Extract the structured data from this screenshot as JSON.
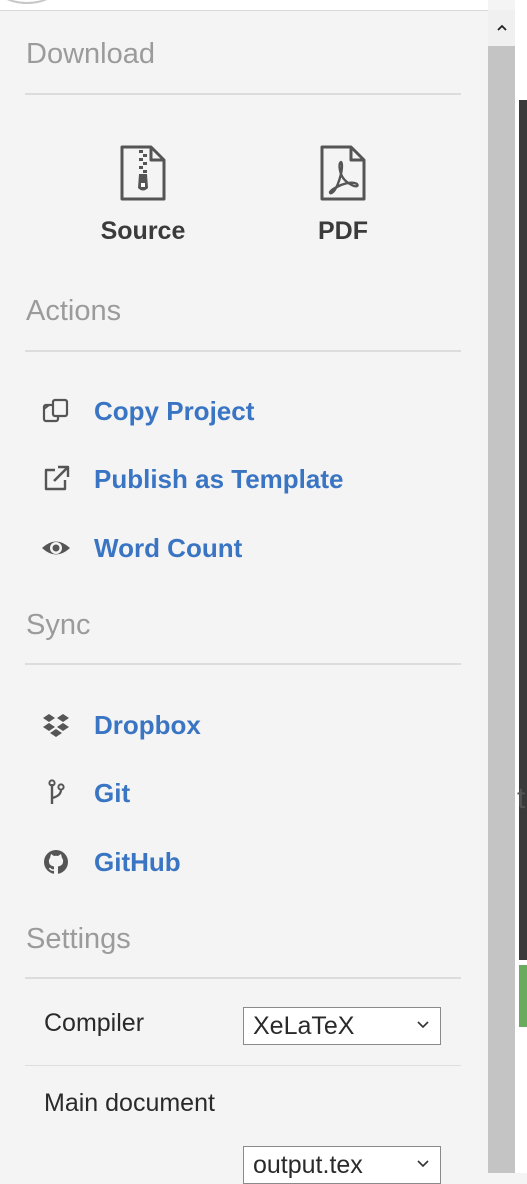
{
  "download": {
    "title": "Download",
    "items": [
      {
        "label": "Source",
        "icon": "zip-file-icon"
      },
      {
        "label": "PDF",
        "icon": "pdf-file-icon"
      }
    ]
  },
  "actions": {
    "title": "Actions",
    "items": [
      {
        "label": "Copy Project",
        "icon": "copy-icon"
      },
      {
        "label": "Publish as Template",
        "icon": "external-link-icon"
      },
      {
        "label": "Word Count",
        "icon": "eye-icon"
      }
    ]
  },
  "sync": {
    "title": "Sync",
    "items": [
      {
        "label": "Dropbox",
        "icon": "dropbox-icon"
      },
      {
        "label": "Git",
        "icon": "git-branch-icon"
      },
      {
        "label": "GitHub",
        "icon": "github-icon"
      }
    ]
  },
  "settings": {
    "title": "Settings",
    "compiler": {
      "label": "Compiler",
      "value": "XeLaTeX"
    },
    "main_document": {
      "label": "Main document",
      "value": "output.tex"
    }
  },
  "behind_panel": {
    "partial_char": "t"
  },
  "colors": {
    "link": "#3a75c4",
    "section_title": "#9b9b9b",
    "background": "#f4f4f4"
  }
}
